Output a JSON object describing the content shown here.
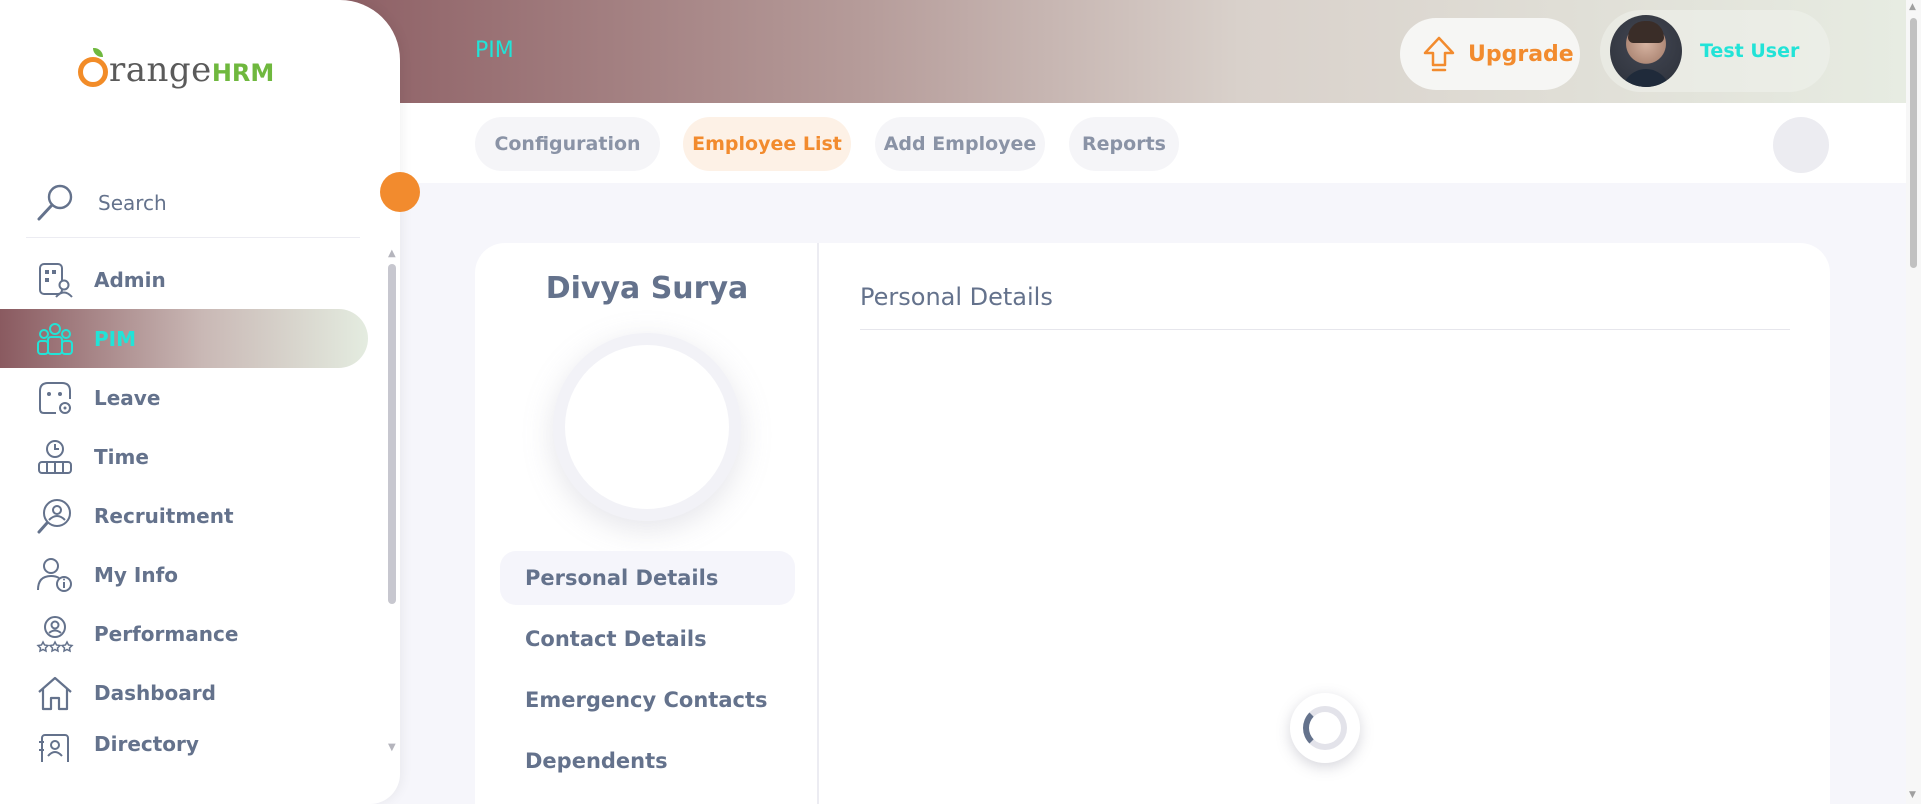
{
  "app": {
    "logo_word": "range",
    "logo_brand": "HRM"
  },
  "colors": {
    "accent": "#f28b2e",
    "active_text": "#22e3d7",
    "text": "#64728c",
    "brand_green": "#6fb83e"
  },
  "sidebar": {
    "search_label": "Search",
    "items": [
      {
        "label": "Admin",
        "icon": "admin-icon"
      },
      {
        "label": "PIM",
        "icon": "pim-icon"
      },
      {
        "label": "Leave",
        "icon": "leave-icon"
      },
      {
        "label": "Time",
        "icon": "time-icon"
      },
      {
        "label": "Recruitment",
        "icon": "recruitment-icon"
      },
      {
        "label": "My Info",
        "icon": "my-info-icon"
      },
      {
        "label": "Performance",
        "icon": "performance-icon"
      },
      {
        "label": "Dashboard",
        "icon": "dashboard-icon"
      },
      {
        "label": "Directory",
        "icon": "directory-icon"
      }
    ]
  },
  "header": {
    "breadcrumb": "PIM",
    "upgrade_label": "Upgrade",
    "user_name": "Test User"
  },
  "subnav": {
    "tabs": [
      {
        "label": "Configuration"
      },
      {
        "label": "Employee List"
      },
      {
        "label": "Add Employee"
      },
      {
        "label": "Reports"
      }
    ]
  },
  "profile": {
    "employee_name": "Divya Surya",
    "nav": [
      {
        "label": "Personal Details"
      },
      {
        "label": "Contact Details"
      },
      {
        "label": "Emergency Contacts"
      },
      {
        "label": "Dependents"
      }
    ]
  },
  "main": {
    "section_title": "Personal Details"
  }
}
